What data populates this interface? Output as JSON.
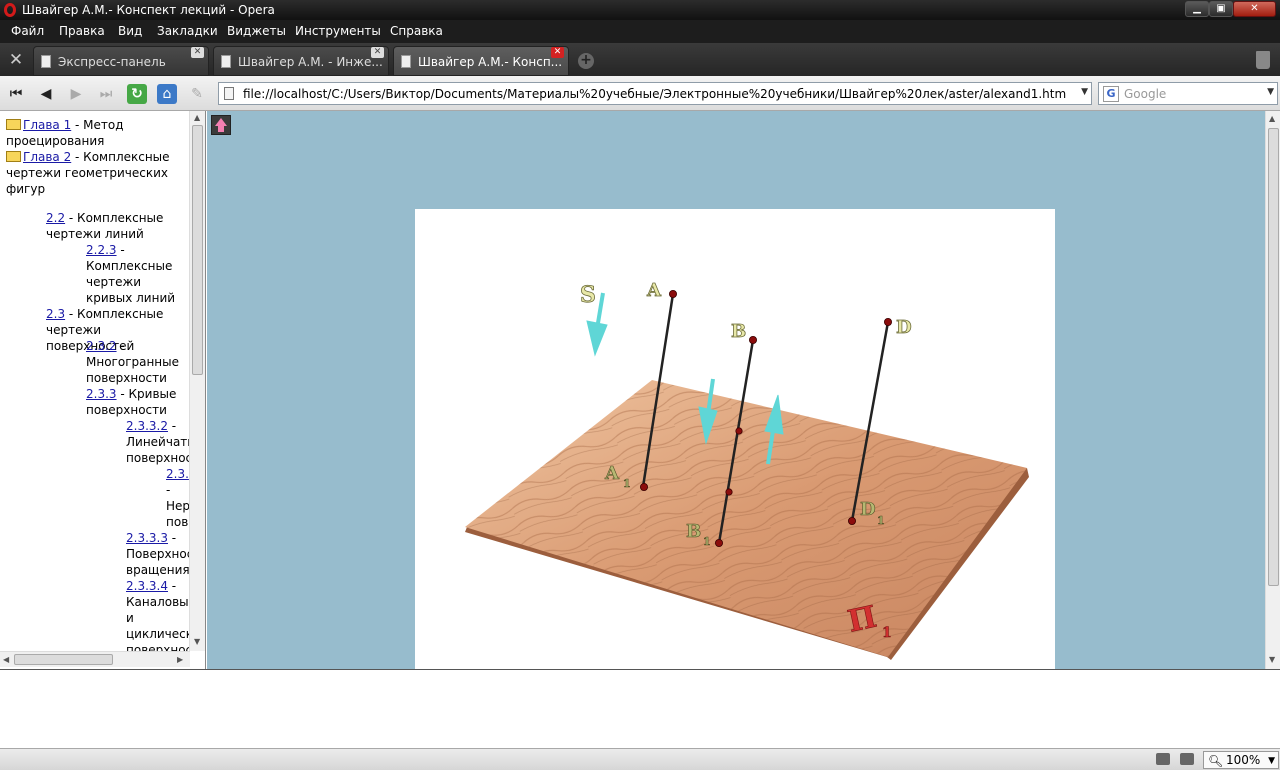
{
  "window": {
    "title": "Швайгер А.М.- Конспект лекций - Opera",
    "minimize": "▁",
    "maximize": "▣",
    "close": "✕"
  },
  "menu": [
    "Файл",
    "Правка",
    "Вид",
    "Закладки",
    "Виджеты",
    "Инструменты",
    "Справка"
  ],
  "tabs": [
    {
      "label": "Экспресс-панель",
      "active": false
    },
    {
      "label": "Швайгер А.М. - Инже...",
      "active": false
    },
    {
      "label": "Швайгер А.М.- Консп...",
      "active": true
    }
  ],
  "toolbar": {
    "back_fast": "⏮",
    "back": "◀",
    "forward": "▶",
    "forward_fast": "⏭",
    "reload": "↻",
    "home": "⌂",
    "edit": "✎"
  },
  "address": {
    "url": "file://localhost/C:/Users/Виктор/Documents/Материалы%20учебные/Электронные%20учебники/Швайгер%20лек/aster/alexand1.htm"
  },
  "search": {
    "engine_icon": "G",
    "placeholder": "Google"
  },
  "toc": {
    "ch1_link": "Глава 1",
    "ch1_text": " - Метод проецирования",
    "ch2_link": "Глава 2",
    "ch2_text": " - Комплексные чертежи геометрических фигур",
    "s22_link": "2.2",
    "s22_text": " - Комплексные чертежи линий",
    "s223_link": "2.2.3",
    "s223_text": " - Комплексные чертежи кривых линий",
    "s23_link": "2.3",
    "s23_text": " - Комплексные чертежи поверхностей",
    "s232_link": "2.3.2",
    "s232_text": " - Многогранные поверхности",
    "s233_link": "2.3.3",
    "s233_text": " - Кривые поверхности",
    "s2332_link": "2.3.3.2",
    "s2332_text": " - Линейчатые поверхности",
    "s2331_link": "2.3.",
    "s2331_text": " - Нер пов",
    "s2333_link": "2.3.3.3",
    "s2333_text": " - Поверхности вращения",
    "s2334_link": "2.3.3.4",
    "s2334_text": " - Каналовые и циклические поверхности"
  },
  "figure": {
    "labels": {
      "S": "S",
      "A": "A",
      "B": "B",
      "D": "D",
      "A1": "A",
      "B1": "B",
      "D1": "D",
      "Pi": "П",
      "sub": "1"
    },
    "colors": {
      "wood_light": "#e8b48d",
      "wood_dark": "#b97651",
      "arrow": "#5fd6d6",
      "point": "#8b0d0d",
      "plane_label": "#d23030",
      "letter": "#e8e8a8"
    }
  },
  "status": {
    "zoom": "100%"
  }
}
